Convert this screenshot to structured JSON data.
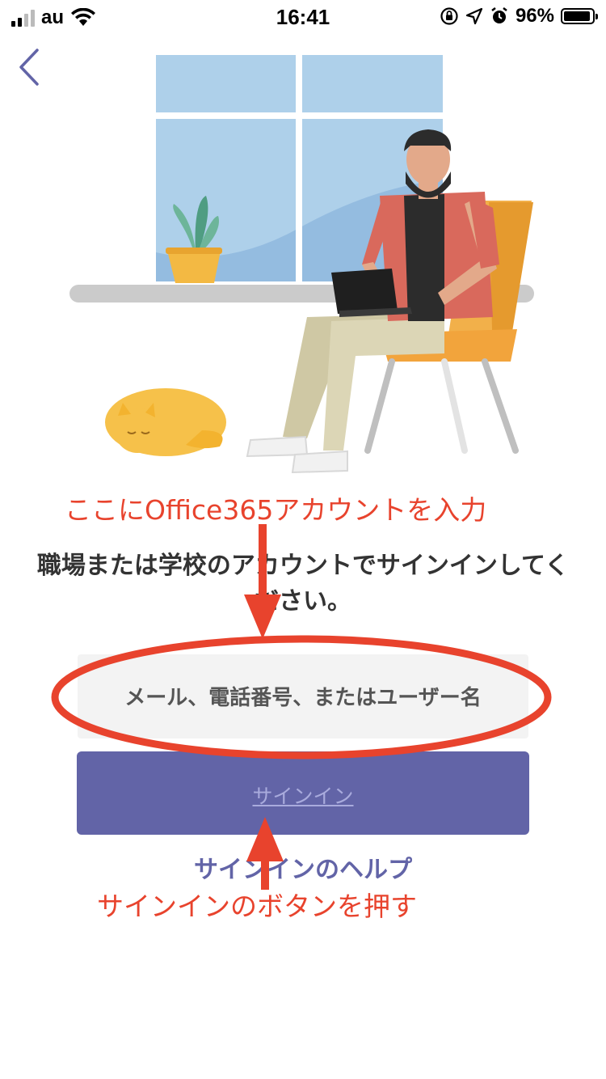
{
  "status_bar": {
    "carrier": "au",
    "time": "16:41",
    "battery_percent": "96%",
    "battery_level": 0.96,
    "icons": [
      "signal-icon",
      "wifi-icon",
      "orientation-lock-icon",
      "location-icon",
      "alarm-icon",
      "battery-icon"
    ]
  },
  "nav": {
    "back_icon": "chevron-left-icon"
  },
  "annotations": {
    "top": "ここにOffice365アカウントを入力",
    "bottom": "サインインのボタンを押す",
    "color": "#e8432d"
  },
  "signin": {
    "heading": "職場または学校のアカウントでサインインしてください。",
    "input_placeholder": "メール、電話番号、またはユーザー名",
    "button_label": "サインイン",
    "help_link": "サインインのヘルプ"
  },
  "colors": {
    "brand": "#6264a7",
    "input_bg": "#f3f3f3",
    "text": "#333333"
  }
}
